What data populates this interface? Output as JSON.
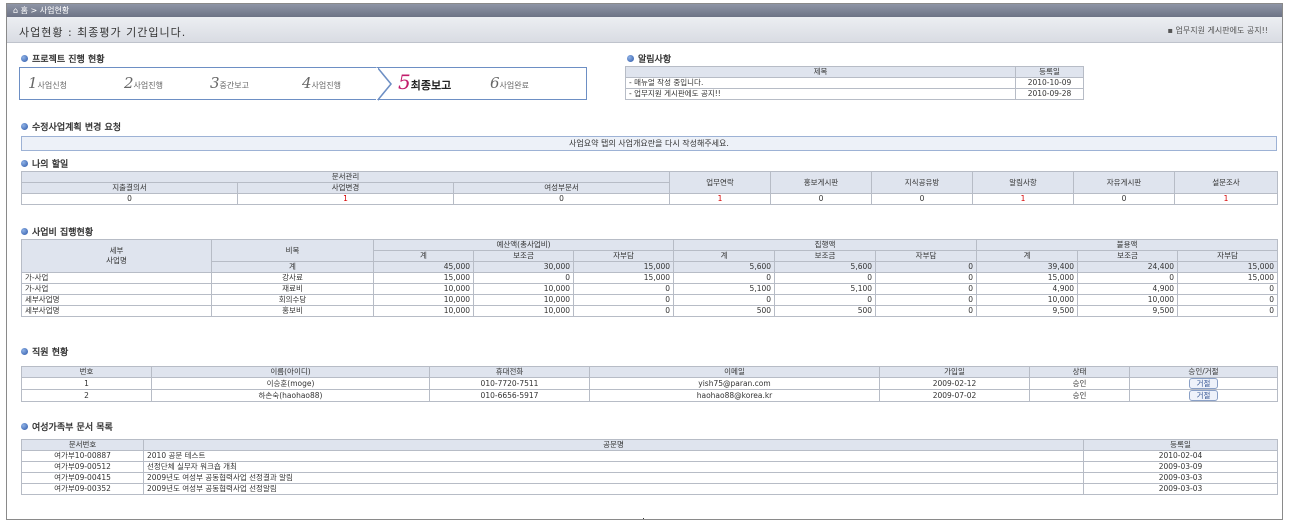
{
  "topbar": {
    "home": "홈",
    "sep": ">",
    "current": "사업현황"
  },
  "titlebar": {
    "title": "사업현황 : 최종평가 기간입니다.",
    "right_link": "▪ 업무지원 게시판에도 공지!!"
  },
  "progress": {
    "heading": "프로젝트 진행 현황",
    "steps": [
      {
        "num": "1",
        "label": "사업신청"
      },
      {
        "num": "2",
        "label": "사업진행"
      },
      {
        "num": "3",
        "label": "중간보고"
      },
      {
        "num": "4",
        "label": "사업진행"
      },
      {
        "num": "5",
        "label": "최종보고"
      },
      {
        "num": "6",
        "label": "사업완료"
      }
    ],
    "active_step": 5
  },
  "notices": {
    "heading": "알림사항",
    "col_title": "제목",
    "col_date": "등록일",
    "rows": [
      {
        "title": "- 매뉴얼 작성 중입니다.",
        "date": "2010-10-09"
      },
      {
        "title": "- 업무지원 게시판에도 공지!!",
        "date": "2010-09-28"
      }
    ]
  },
  "change_request": {
    "heading": "수정사업계획 변경 요청",
    "message": "사업요약 탭의 사업개요란을 다시 작성해주세요."
  },
  "todo": {
    "heading": "나의 할일",
    "group": "문서관리",
    "group_cols": [
      "지출결의서",
      "사업변경",
      "여성부문서"
    ],
    "cols": [
      "업무연락",
      "홍보게시판",
      "지식공유방",
      "알림사항",
      "자유게시판",
      "설문조사"
    ],
    "values": [
      "0",
      "1",
      "0",
      "1",
      "0",
      "0",
      "1",
      "0",
      "1"
    ]
  },
  "budget": {
    "heading": "사업비 집행현황",
    "h_project": "세부\n사업명",
    "h_item": "비목",
    "h_groups": [
      "예산액(총사업비)",
      "집행액",
      "불용액"
    ],
    "h_sub": [
      "계",
      "보조금",
      "자부담"
    ],
    "total_label": "계",
    "total": [
      "45,000",
      "30,000",
      "15,000",
      "5,600",
      "5,600",
      "0",
      "39,400",
      "24,400",
      "15,000"
    ],
    "rows": [
      {
        "project": "가-사업",
        "item": "강사료",
        "vals": [
          "15,000",
          "0",
          "15,000",
          "0",
          "0",
          "0",
          "15,000",
          "0",
          "15,000"
        ]
      },
      {
        "project": "가-사업",
        "item": "재료비",
        "vals": [
          "10,000",
          "10,000",
          "0",
          "5,100",
          "5,100",
          "0",
          "4,900",
          "4,900",
          "0"
        ]
      },
      {
        "project": "세부사업명",
        "item": "회의수당",
        "vals": [
          "10,000",
          "10,000",
          "0",
          "0",
          "0",
          "0",
          "10,000",
          "10,000",
          "0"
        ]
      },
      {
        "project": "세부사업명",
        "item": "홍보비",
        "vals": [
          "10,000",
          "10,000",
          "0",
          "500",
          "500",
          "0",
          "9,500",
          "9,500",
          "0"
        ]
      }
    ]
  },
  "staff": {
    "heading": "직원 현황",
    "cols": [
      "번호",
      "이름(아이디)",
      "휴대전화",
      "이메일",
      "가입일",
      "상태",
      "승인/거절"
    ],
    "rows": [
      {
        "no": "1",
        "name": "이승훈(moge)",
        "phone": "010-7720-7511",
        "email": "yish75@paran.com",
        "joined": "2009-02-12",
        "status": "승인",
        "action": "거절"
      },
      {
        "no": "2",
        "name": "하손숙(haohao88)",
        "phone": "010-6656-5917",
        "email": "haohao88@korea.kr",
        "joined": "2009-07-02",
        "status": "승인",
        "action": "거절"
      }
    ]
  },
  "docs": {
    "heading": "여성가족부 문서 목록",
    "cols": [
      "문서번호",
      "공문명",
      "등록일"
    ],
    "rows": [
      {
        "no": "여가부10-00887",
        "title": "2010 공문 테스트",
        "date": "2010-02-04"
      },
      {
        "no": "여가부09-00512",
        "title": "선정단체 실무자 워크숍 개최",
        "date": "2009-03-09"
      },
      {
        "no": "여가부09-00415",
        "title": "2009년도 여성부 공동협력사업 선정결과 알림",
        "date": "2009-03-03"
      },
      {
        "no": "여가부09-00352",
        "title": "2009년도 여성부 공동협력사업 선정알림",
        "date": "2009-03-03"
      }
    ]
  },
  "colors": {
    "accent": "#2c57a8",
    "active_step": "#c21d6c",
    "alert": "#d60000"
  }
}
